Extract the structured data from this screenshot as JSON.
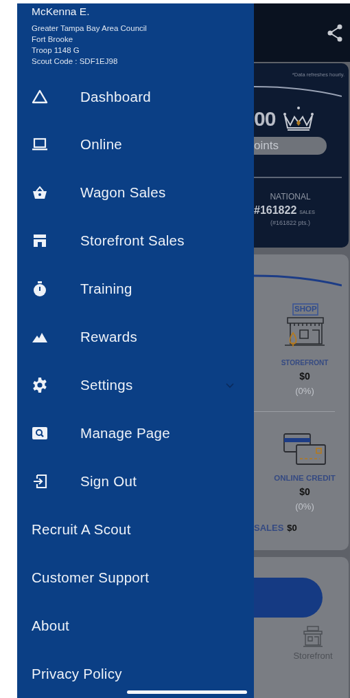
{
  "drawer": {
    "user": {
      "name": "McKenna E.",
      "details": [
        "Greater Tampa Bay Area Council",
        "Fort Brooke",
        "Troop 1148 G",
        "Scout Code : SDF1EJ98"
      ]
    },
    "menu": [
      {
        "label": "Dashboard"
      },
      {
        "label": "Online"
      },
      {
        "label": "Wagon Sales"
      },
      {
        "label": "Storefront Sales"
      },
      {
        "label": "Training"
      },
      {
        "label": "Rewards"
      },
      {
        "label": "Settings",
        "expanded": false
      },
      {
        "label": "Manage Page"
      },
      {
        "label": "Sign Out"
      }
    ],
    "links": [
      "Recruit A Scout",
      "Customer Support",
      "About",
      "Privacy Policy"
    ]
  },
  "background": {
    "summary_card": {
      "note": "*Data refreshes hourly.",
      "points_value": "00",
      "points_label": "oints",
      "rank_label": "NATIONAL",
      "rank_value": "#161822",
      "rank_unit": "SALES",
      "rank_points": "(#161822 pts.)"
    },
    "sales_card": {
      "categories": [
        {
          "sign": "SHOP",
          "title": "STOREFRONT",
          "amount": "$0",
          "percent": "(0%)"
        },
        {
          "title": "ONLINE CREDIT",
          "amount": "$0",
          "percent": "(0%)"
        }
      ],
      "total_label": "SALES",
      "total_value": "$0"
    },
    "tab_bar": {
      "tabs": [
        {
          "label": "Storefront"
        }
      ]
    }
  }
}
